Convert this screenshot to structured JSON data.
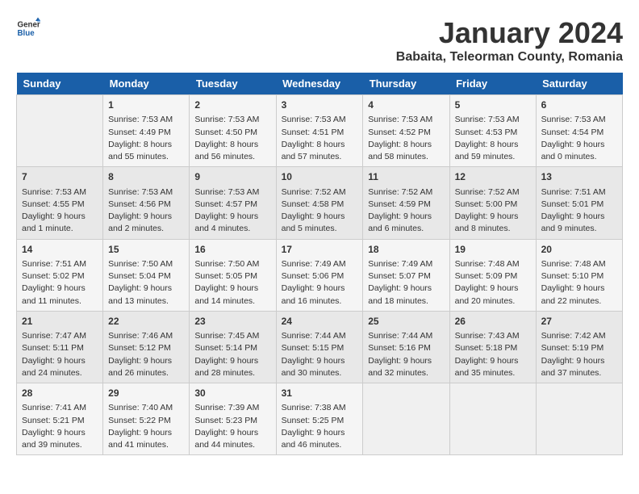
{
  "header": {
    "logo_general": "General",
    "logo_blue": "Blue",
    "month_title": "January 2024",
    "location": "Babaita, Teleorman County, Romania"
  },
  "days_of_week": [
    "Sunday",
    "Monday",
    "Tuesday",
    "Wednesday",
    "Thursday",
    "Friday",
    "Saturday"
  ],
  "weeks": [
    [
      {
        "day": "",
        "sunrise": "",
        "sunset": "",
        "daylight": ""
      },
      {
        "day": "1",
        "sunrise": "Sunrise: 7:53 AM",
        "sunset": "Sunset: 4:49 PM",
        "daylight": "Daylight: 8 hours and 55 minutes."
      },
      {
        "day": "2",
        "sunrise": "Sunrise: 7:53 AM",
        "sunset": "Sunset: 4:50 PM",
        "daylight": "Daylight: 8 hours and 56 minutes."
      },
      {
        "day": "3",
        "sunrise": "Sunrise: 7:53 AM",
        "sunset": "Sunset: 4:51 PM",
        "daylight": "Daylight: 8 hours and 57 minutes."
      },
      {
        "day": "4",
        "sunrise": "Sunrise: 7:53 AM",
        "sunset": "Sunset: 4:52 PM",
        "daylight": "Daylight: 8 hours and 58 minutes."
      },
      {
        "day": "5",
        "sunrise": "Sunrise: 7:53 AM",
        "sunset": "Sunset: 4:53 PM",
        "daylight": "Daylight: 8 hours and 59 minutes."
      },
      {
        "day": "6",
        "sunrise": "Sunrise: 7:53 AM",
        "sunset": "Sunset: 4:54 PM",
        "daylight": "Daylight: 9 hours and 0 minutes."
      }
    ],
    [
      {
        "day": "7",
        "sunrise": "Sunrise: 7:53 AM",
        "sunset": "Sunset: 4:55 PM",
        "daylight": "Daylight: 9 hours and 1 minute."
      },
      {
        "day": "8",
        "sunrise": "Sunrise: 7:53 AM",
        "sunset": "Sunset: 4:56 PM",
        "daylight": "Daylight: 9 hours and 2 minutes."
      },
      {
        "day": "9",
        "sunrise": "Sunrise: 7:53 AM",
        "sunset": "Sunset: 4:57 PM",
        "daylight": "Daylight: 9 hours and 4 minutes."
      },
      {
        "day": "10",
        "sunrise": "Sunrise: 7:52 AM",
        "sunset": "Sunset: 4:58 PM",
        "daylight": "Daylight: 9 hours and 5 minutes."
      },
      {
        "day": "11",
        "sunrise": "Sunrise: 7:52 AM",
        "sunset": "Sunset: 4:59 PM",
        "daylight": "Daylight: 9 hours and 6 minutes."
      },
      {
        "day": "12",
        "sunrise": "Sunrise: 7:52 AM",
        "sunset": "Sunset: 5:00 PM",
        "daylight": "Daylight: 9 hours and 8 minutes."
      },
      {
        "day": "13",
        "sunrise": "Sunrise: 7:51 AM",
        "sunset": "Sunset: 5:01 PM",
        "daylight": "Daylight: 9 hours and 9 minutes."
      }
    ],
    [
      {
        "day": "14",
        "sunrise": "Sunrise: 7:51 AM",
        "sunset": "Sunset: 5:02 PM",
        "daylight": "Daylight: 9 hours and 11 minutes."
      },
      {
        "day": "15",
        "sunrise": "Sunrise: 7:50 AM",
        "sunset": "Sunset: 5:04 PM",
        "daylight": "Daylight: 9 hours and 13 minutes."
      },
      {
        "day": "16",
        "sunrise": "Sunrise: 7:50 AM",
        "sunset": "Sunset: 5:05 PM",
        "daylight": "Daylight: 9 hours and 14 minutes."
      },
      {
        "day": "17",
        "sunrise": "Sunrise: 7:49 AM",
        "sunset": "Sunset: 5:06 PM",
        "daylight": "Daylight: 9 hours and 16 minutes."
      },
      {
        "day": "18",
        "sunrise": "Sunrise: 7:49 AM",
        "sunset": "Sunset: 5:07 PM",
        "daylight": "Daylight: 9 hours and 18 minutes."
      },
      {
        "day": "19",
        "sunrise": "Sunrise: 7:48 AM",
        "sunset": "Sunset: 5:09 PM",
        "daylight": "Daylight: 9 hours and 20 minutes."
      },
      {
        "day": "20",
        "sunrise": "Sunrise: 7:48 AM",
        "sunset": "Sunset: 5:10 PM",
        "daylight": "Daylight: 9 hours and 22 minutes."
      }
    ],
    [
      {
        "day": "21",
        "sunrise": "Sunrise: 7:47 AM",
        "sunset": "Sunset: 5:11 PM",
        "daylight": "Daylight: 9 hours and 24 minutes."
      },
      {
        "day": "22",
        "sunrise": "Sunrise: 7:46 AM",
        "sunset": "Sunset: 5:12 PM",
        "daylight": "Daylight: 9 hours and 26 minutes."
      },
      {
        "day": "23",
        "sunrise": "Sunrise: 7:45 AM",
        "sunset": "Sunset: 5:14 PM",
        "daylight": "Daylight: 9 hours and 28 minutes."
      },
      {
        "day": "24",
        "sunrise": "Sunrise: 7:44 AM",
        "sunset": "Sunset: 5:15 PM",
        "daylight": "Daylight: 9 hours and 30 minutes."
      },
      {
        "day": "25",
        "sunrise": "Sunrise: 7:44 AM",
        "sunset": "Sunset: 5:16 PM",
        "daylight": "Daylight: 9 hours and 32 minutes."
      },
      {
        "day": "26",
        "sunrise": "Sunrise: 7:43 AM",
        "sunset": "Sunset: 5:18 PM",
        "daylight": "Daylight: 9 hours and 35 minutes."
      },
      {
        "day": "27",
        "sunrise": "Sunrise: 7:42 AM",
        "sunset": "Sunset: 5:19 PM",
        "daylight": "Daylight: 9 hours and 37 minutes."
      }
    ],
    [
      {
        "day": "28",
        "sunrise": "Sunrise: 7:41 AM",
        "sunset": "Sunset: 5:21 PM",
        "daylight": "Daylight: 9 hours and 39 minutes."
      },
      {
        "day": "29",
        "sunrise": "Sunrise: 7:40 AM",
        "sunset": "Sunset: 5:22 PM",
        "daylight": "Daylight: 9 hours and 41 minutes."
      },
      {
        "day": "30",
        "sunrise": "Sunrise: 7:39 AM",
        "sunset": "Sunset: 5:23 PM",
        "daylight": "Daylight: 9 hours and 44 minutes."
      },
      {
        "day": "31",
        "sunrise": "Sunrise: 7:38 AM",
        "sunset": "Sunset: 5:25 PM",
        "daylight": "Daylight: 9 hours and 46 minutes."
      },
      {
        "day": "",
        "sunrise": "",
        "sunset": "",
        "daylight": ""
      },
      {
        "day": "",
        "sunrise": "",
        "sunset": "",
        "daylight": ""
      },
      {
        "day": "",
        "sunrise": "",
        "sunset": "",
        "daylight": ""
      }
    ]
  ]
}
